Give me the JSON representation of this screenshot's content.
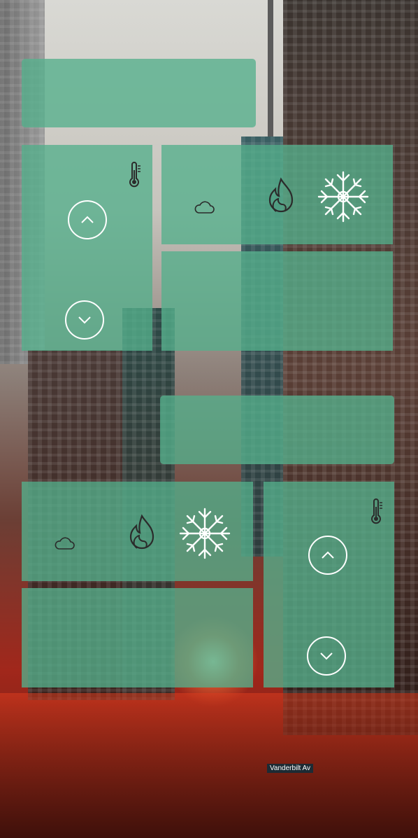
{
  "colors": {
    "tile": "#54af8c",
    "icon_dark": "#2b2b2b",
    "icon_light": "#ffffff"
  },
  "tiles": {
    "top_banner": {
      "label": ""
    },
    "thermostat_1": {
      "icon": "thermometer-icon",
      "up": "chevron-up-icon",
      "down": "chevron-down-icon"
    },
    "mode_1": {
      "icons": [
        "cloud-icon",
        "flame-icon",
        "snowflake-icon"
      ]
    },
    "blank_1": {
      "label": ""
    },
    "middle_banner": {
      "label": ""
    },
    "mode_2": {
      "icons": [
        "cloud-icon",
        "flame-icon",
        "snowflake-icon"
      ]
    },
    "blank_2": {
      "label": ""
    },
    "thermostat_2": {
      "icon": "thermometer-icon",
      "up": "chevron-up-icon",
      "down": "chevron-down-icon"
    }
  },
  "background": {
    "sign_text": "Vanderbilt Av"
  }
}
